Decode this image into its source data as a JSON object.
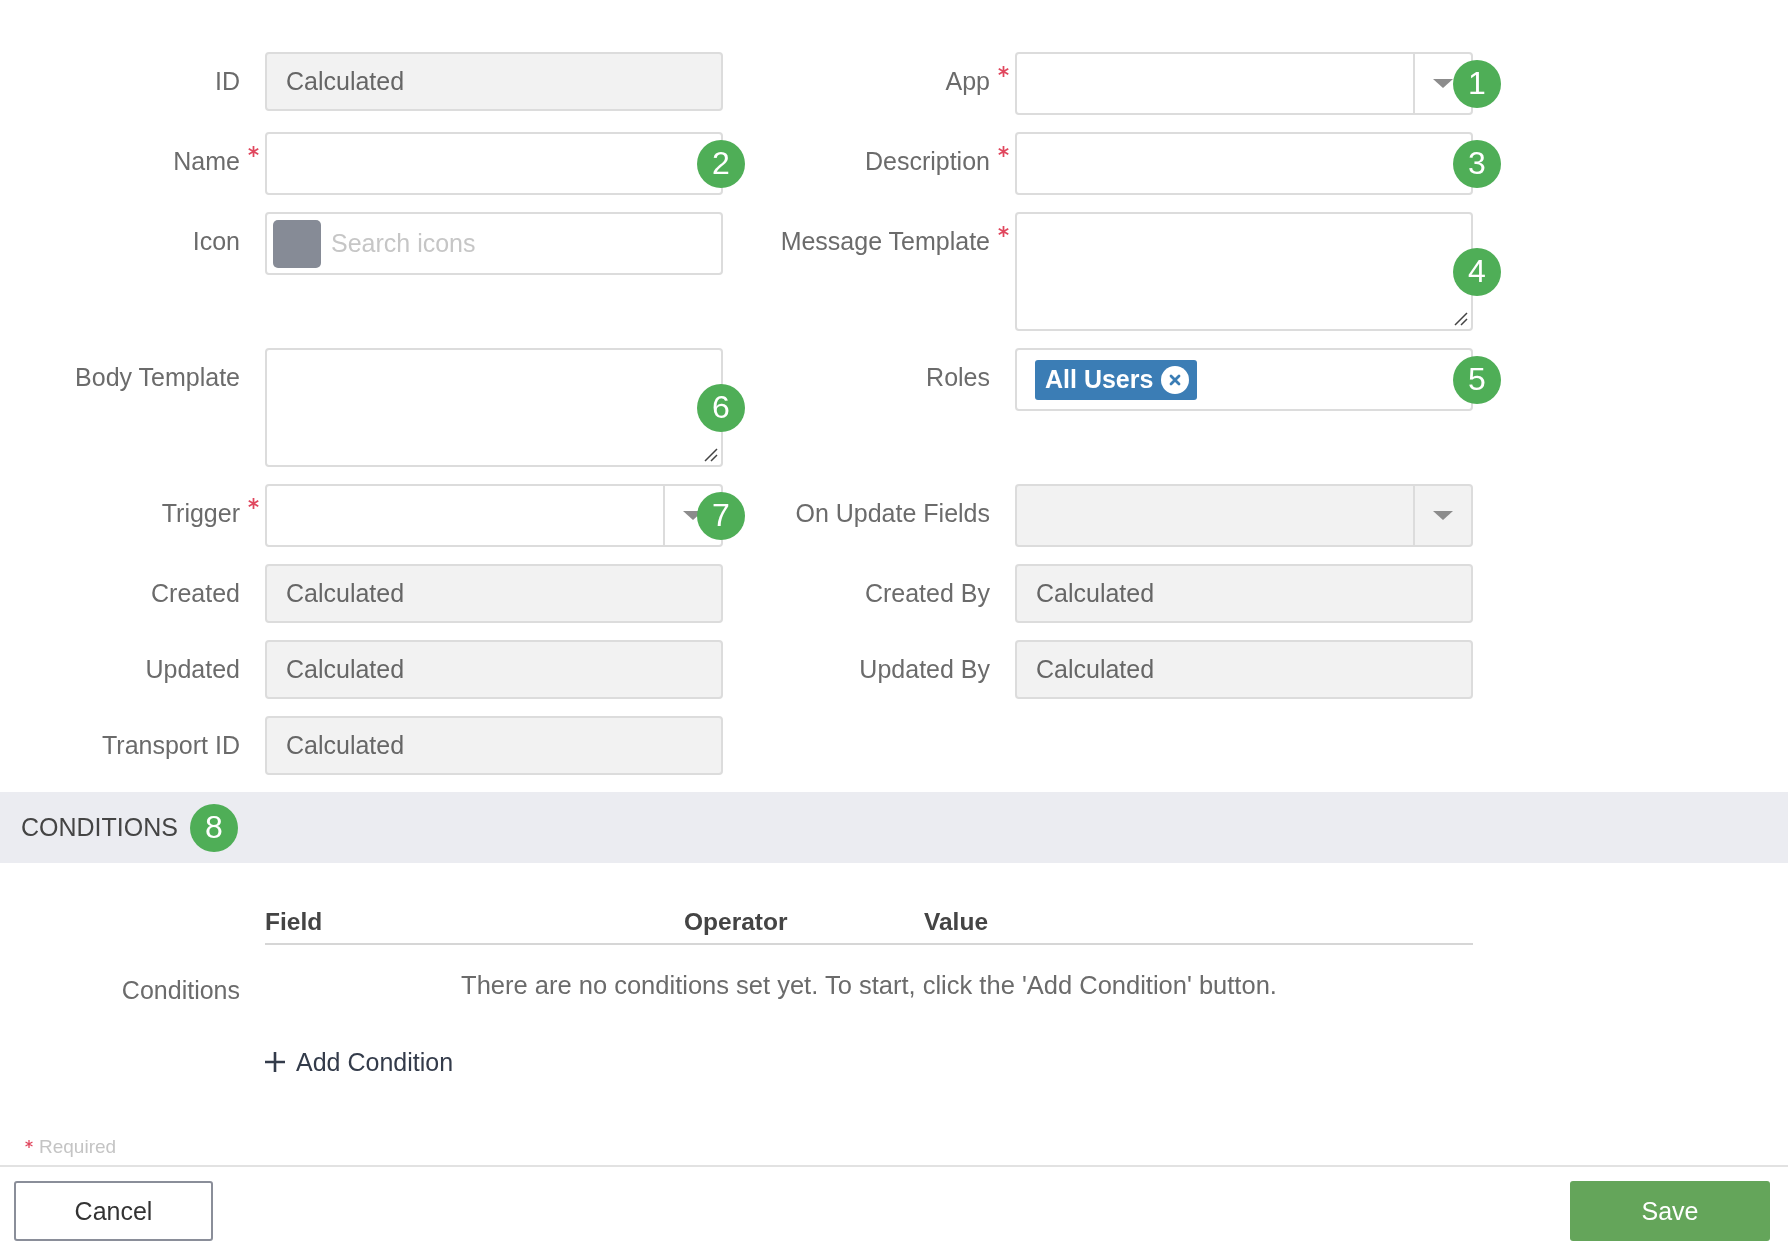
{
  "form": {
    "rows": [
      {
        "left": {
          "label": "ID",
          "required": false,
          "kind": "text",
          "disabled": true,
          "value": "Calculated"
        },
        "right": {
          "label": "App",
          "required": true,
          "kind": "select",
          "disabled": false,
          "callout": "1"
        }
      },
      {
        "left": {
          "label": "Name",
          "required": true,
          "kind": "text",
          "disabled": false,
          "callout": "2"
        },
        "right": {
          "label": "Description",
          "required": true,
          "kind": "text",
          "disabled": false,
          "callout": "3"
        }
      },
      {
        "left": {
          "label": "Icon",
          "required": false,
          "kind": "icon_search",
          "placeholder": "Search icons"
        },
        "right": {
          "label": "Message Template",
          "required": true,
          "kind": "textarea",
          "callout": "4"
        }
      },
      {
        "left": {
          "label": "Body Template",
          "required": false,
          "kind": "textarea",
          "callout": "6"
        },
        "right": {
          "label": "Roles",
          "required": false,
          "kind": "tags",
          "tags": [
            {
              "label": "All Users"
            }
          ],
          "callout": "5"
        }
      },
      {
        "left": {
          "label": "Trigger",
          "required": true,
          "kind": "select",
          "disabled": false,
          "callout": "7"
        },
        "right": {
          "label": "On Update Fields",
          "required": false,
          "kind": "select",
          "disabled": true
        }
      },
      {
        "left": {
          "label": "Created",
          "required": false,
          "kind": "text",
          "disabled": true,
          "value": "Calculated"
        },
        "right": {
          "label": "Created By",
          "required": false,
          "kind": "text",
          "disabled": true,
          "value": "Calculated"
        }
      },
      {
        "left": {
          "label": "Updated",
          "required": false,
          "kind": "text",
          "disabled": true,
          "value": "Calculated"
        },
        "right": {
          "label": "Updated By",
          "required": false,
          "kind": "text",
          "disabled": true,
          "value": "Calculated"
        }
      },
      {
        "left": {
          "label": "Transport ID",
          "required": false,
          "kind": "text",
          "disabled": true,
          "value": "Calculated"
        }
      }
    ]
  },
  "conditions": {
    "title": "CONDITIONS",
    "callout": "8",
    "label": "Conditions",
    "columns": [
      "Field",
      "Operator",
      "Value"
    ],
    "empty_message": "There are no conditions set yet. To start, click the 'Add Condition' button.",
    "add_button": "Add Condition"
  },
  "required_note": "Required",
  "buttons": [
    {
      "kind": "secondary",
      "label": "Cancel"
    },
    {
      "kind": "primary",
      "label": "Save"
    }
  ]
}
